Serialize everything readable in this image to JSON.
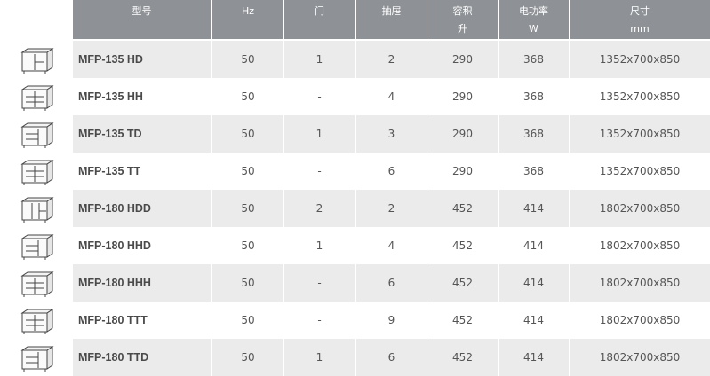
{
  "headers": {
    "model": "型号",
    "hz": "Hz",
    "door": "门",
    "drawer": "抽屉",
    "volume": "容积",
    "volume_unit": "升",
    "power": "电功率",
    "power_unit": "W",
    "size": "尺寸",
    "size_unit": "mm"
  },
  "rows": [
    {
      "icon": "counter-fridge-door-drawer-icon",
      "model": "MFP-135 HD",
      "hz": "50",
      "door": "1",
      "drawer": "2",
      "volume": "290",
      "power": "368",
      "size": "1352x700x850"
    },
    {
      "icon": "counter-fridge-drawers-icon",
      "model": "MFP-135 HH",
      "hz": "50",
      "door": "-",
      "drawer": "4",
      "volume": "290",
      "power": "368",
      "size": "1352x700x850"
    },
    {
      "icon": "counter-fridge-drawer-door-icon",
      "model": "MFP-135 TD",
      "hz": "50",
      "door": "1",
      "drawer": "3",
      "volume": "290",
      "power": "368",
      "size": "1352x700x850"
    },
    {
      "icon": "counter-fridge-drawers-icon",
      "model": "MFP-135 TT",
      "hz": "50",
      "door": "-",
      "drawer": "6",
      "volume": "290",
      "power": "368",
      "size": "1352x700x850"
    },
    {
      "icon": "counter-fridge-doors-icon",
      "model": "MFP-180 HDD",
      "hz": "50",
      "door": "2",
      "drawer": "2",
      "volume": "452",
      "power": "414",
      "size": "1802x700x850"
    },
    {
      "icon": "counter-fridge-drawer-door-icon",
      "model": "MFP-180 HHD",
      "hz": "50",
      "door": "1",
      "drawer": "4",
      "volume": "452",
      "power": "414",
      "size": "1802x700x850"
    },
    {
      "icon": "counter-fridge-drawers-icon",
      "model": "MFP-180 HHH",
      "hz": "50",
      "door": "-",
      "drawer": "6",
      "volume": "452",
      "power": "414",
      "size": "1802x700x850"
    },
    {
      "icon": "counter-fridge-drawers-icon",
      "model": "MFP-180 TTT",
      "hz": "50",
      "door": "-",
      "drawer": "9",
      "volume": "452",
      "power": "414",
      "size": "1802x700x850"
    },
    {
      "icon": "counter-fridge-drawer-door-icon",
      "model": "MFP-180 TTD",
      "hz": "50",
      "door": "1",
      "drawer": "6",
      "volume": "452",
      "power": "414",
      "size": "1802x700x850"
    }
  ]
}
